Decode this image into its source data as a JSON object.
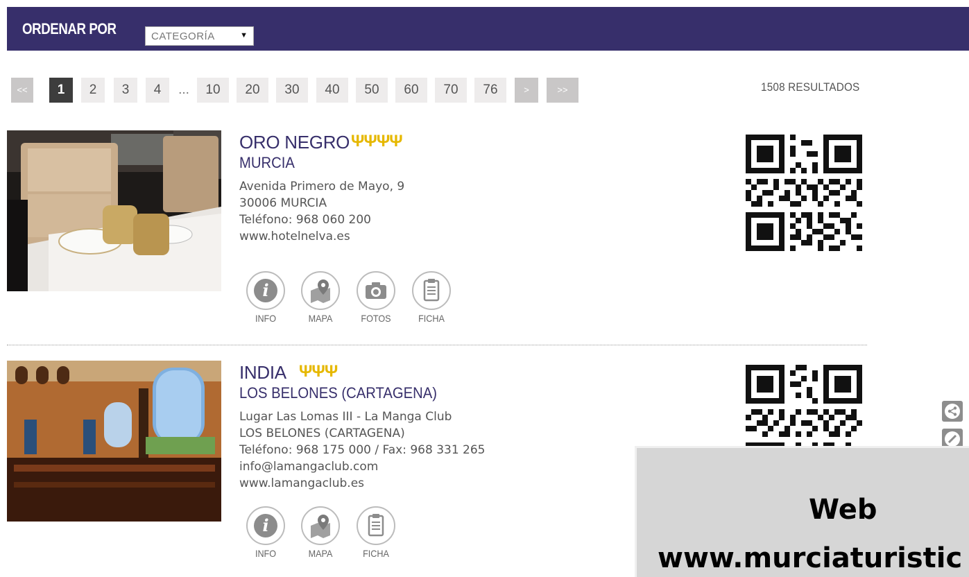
{
  "toolbar": {
    "sort_label": "ORDENAR POR",
    "sort_value": "CATEGORÍA",
    "sort_arrow": "▼"
  },
  "pagination": {
    "first": "<<",
    "pages": [
      "1",
      "2",
      "3",
      "4",
      "10",
      "20",
      "30",
      "40",
      "50",
      "60",
      "70",
      "76"
    ],
    "ellipsis": "...",
    "next": ">",
    "last": ">>",
    "current": "1"
  },
  "results_count": "1508 RESULTADOS",
  "listings": [
    {
      "name": "ORO NEGRO",
      "forks": "ΨΨΨΨ",
      "rating": 4,
      "city": "MURCIA",
      "lines": [
        "Avenida Primero de Mayo, 9",
        "30006 MURCIA",
        "Teléfono: 968 060 200",
        "www.hotelnelva.es"
      ],
      "actions": [
        "INFO",
        "MAPA",
        "FOTOS",
        "FICHA"
      ]
    },
    {
      "name": "INDIA",
      "forks": "ΨΨΨ",
      "rating": 3,
      "city": "LOS BELONES (CARTAGENA)",
      "lines": [
        "Lugar Las Lomas III - La Manga Club",
        "LOS BELONES (CARTAGENA)",
        "Teléfono: 968 175 000 / Fax: 968 331 265",
        "info@lamangaclub.com",
        "www.lamangaclub.es"
      ],
      "actions": [
        "INFO",
        "MAPA",
        "FICHA"
      ]
    }
  ],
  "overlay": {
    "line1": "Web",
    "line2": "www.murciaturistic"
  },
  "colors": {
    "brand": "#372f6b",
    "fork": "#e6b800",
    "pager_bg": "#eeecec",
    "pager_active": "#3d3d3d"
  }
}
